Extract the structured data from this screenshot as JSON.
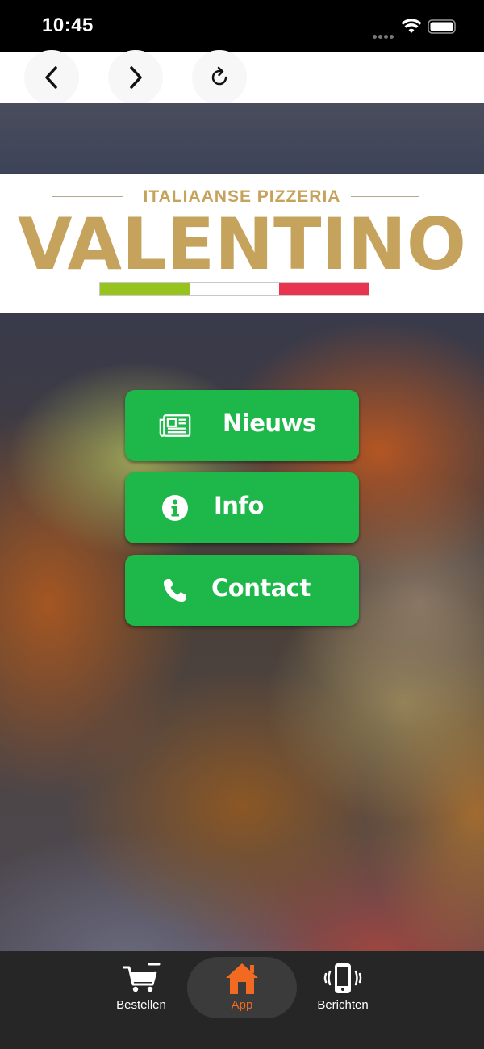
{
  "status_bar": {
    "time": "10:45"
  },
  "browser": {
    "back_icon": "chevron-left-icon",
    "forward_icon": "chevron-right-icon",
    "reload_icon": "reload-icon"
  },
  "logo": {
    "subtitle": "ITALIAANSE PIZZERIA",
    "title": "VALENTINO",
    "gold": "#c6a35c",
    "flag_colors": [
      "#96c31e",
      "#ffffff",
      "#e8344e"
    ]
  },
  "menu": {
    "accent": "#1eb84a",
    "items": [
      {
        "label": "Nieuws",
        "icon": "newspaper-icon"
      },
      {
        "label": "Info",
        "icon": "info-circle-icon"
      },
      {
        "label": "Contact",
        "icon": "phone-icon"
      }
    ]
  },
  "tabbar": {
    "active_color": "#f26a21",
    "tabs": [
      {
        "label": "Bestellen",
        "icon": "cart-icon"
      },
      {
        "label": "App",
        "icon": "home-icon",
        "active": true
      },
      {
        "label": "Berichten",
        "icon": "phone-vibrate-icon"
      }
    ]
  }
}
